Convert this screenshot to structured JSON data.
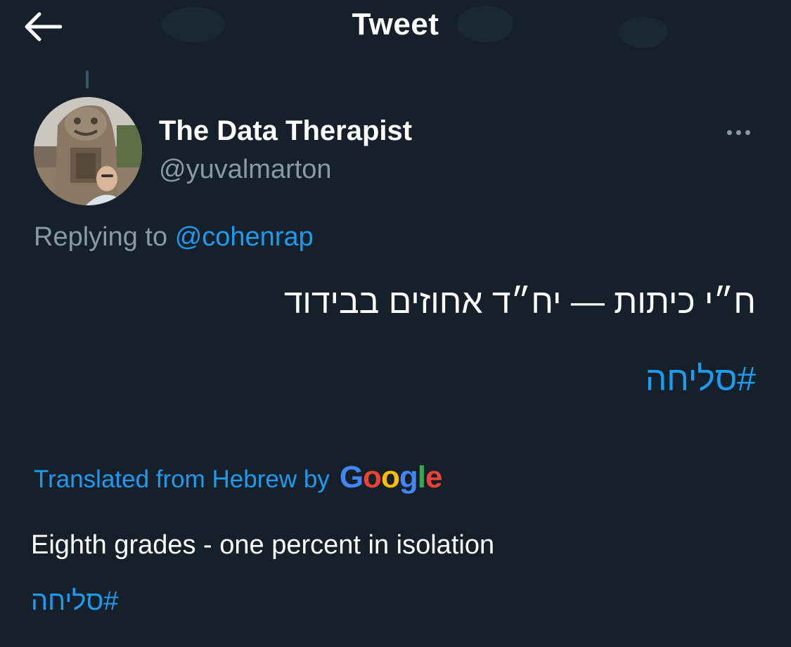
{
  "header": {
    "title": "Tweet",
    "back_icon": "arrow-left-icon"
  },
  "tweet": {
    "author": {
      "display_name": "The Data Therapist",
      "handle": "@yuvalmarton"
    },
    "more_icon": "more-horizontal-icon",
    "replying_to": {
      "prefix": "Replying to",
      "mention": "@cohenrap"
    },
    "text": "ח״י כיתות — יח״ד אחוזים בבידוד",
    "hashtag": "#סליחה",
    "translation": {
      "label": "Translated from Hebrew by",
      "provider_letters": [
        "G",
        "o",
        "o",
        "g",
        "l",
        "e"
      ],
      "text": "Eighth grades - one percent in isolation",
      "hashtag": "#סליחה"
    }
  },
  "colors": {
    "background": "#15202b",
    "accent": "#1d9bf0",
    "secondary_text": "#8b98a5",
    "primary_text": "#ffffff"
  }
}
